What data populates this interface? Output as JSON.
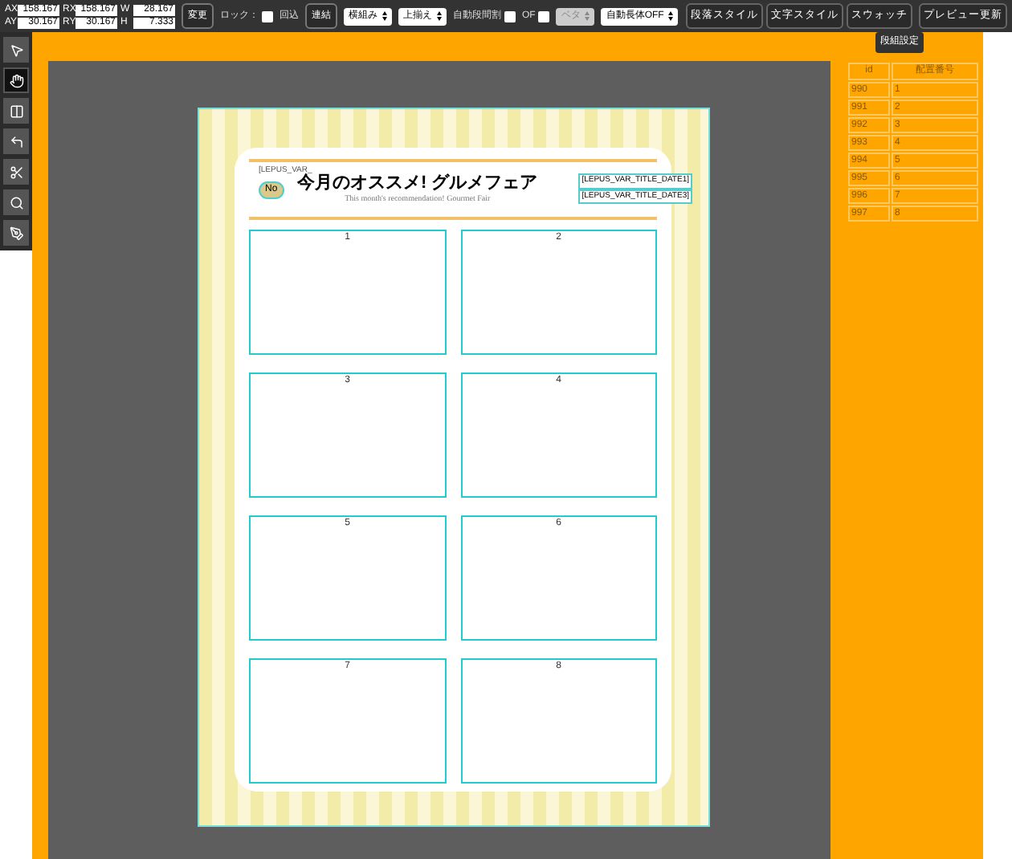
{
  "toolbar": {
    "coords": [
      {
        "label": "AX",
        "value": "158.167"
      },
      {
        "label": "AY",
        "value": "30.167"
      },
      {
        "label": "RX",
        "value": "158.167"
      },
      {
        "label": "RY",
        "value": "30.167"
      },
      {
        "label": "W",
        "value": "28.167"
      },
      {
        "label": "H",
        "value": "7.333"
      }
    ],
    "controls": [
      {
        "kind": "button",
        "label": "変更"
      },
      {
        "kind": "checkbox",
        "label": "ロック：",
        "checked": false
      },
      {
        "kind": "text",
        "label": "回込"
      },
      {
        "kind": "button",
        "label": "連結"
      },
      {
        "kind": "select",
        "label": "横組み",
        "disabled": false
      },
      {
        "kind": "select",
        "label": "上揃え",
        "disabled": false
      },
      {
        "kind": "checkbox",
        "label": "自動段間割",
        "checked": false
      },
      {
        "kind": "checkbox",
        "label": "OF",
        "checked": false
      },
      {
        "kind": "select",
        "label": "ベタ",
        "disabled": true
      },
      {
        "kind": "select",
        "label": "自動長体OFF",
        "disabled": false
      }
    ],
    "right_buttons": [
      "段落スタイル",
      "文字スタイル",
      "スウォッチ"
    ],
    "tooltip": "段組設定",
    "preview_button": "プレビュー更新"
  },
  "tools": [
    {
      "selected": false
    },
    {
      "selected": true
    },
    {
      "selected": false
    },
    {
      "selected": false
    },
    {
      "selected": false
    },
    {
      "selected": false
    },
    {
      "selected": false
    }
  ],
  "document": {
    "no_label": "No",
    "no_var": "[LEPUS_VAR_",
    "title": "今月のオススメ! グルメフェア",
    "subtitle": "This month's recommendation! Gourmet Fair",
    "date_vars": [
      "[LEPUS_VAR_TITLE_DATE1]",
      "[LEPUS_VAR_TITLE_DATE3]"
    ],
    "slots": [
      "1",
      "2",
      "3",
      "4",
      "5",
      "6",
      "7",
      "8"
    ]
  },
  "table": {
    "columns": [
      "id",
      "配置番号"
    ],
    "rows": [
      [
        "990",
        "1"
      ],
      [
        "991",
        "2"
      ],
      [
        "992",
        "3"
      ],
      [
        "993",
        "4"
      ],
      [
        "994",
        "5"
      ],
      [
        "995",
        "6"
      ],
      [
        "996",
        "7"
      ],
      [
        "997",
        "8"
      ]
    ]
  }
}
